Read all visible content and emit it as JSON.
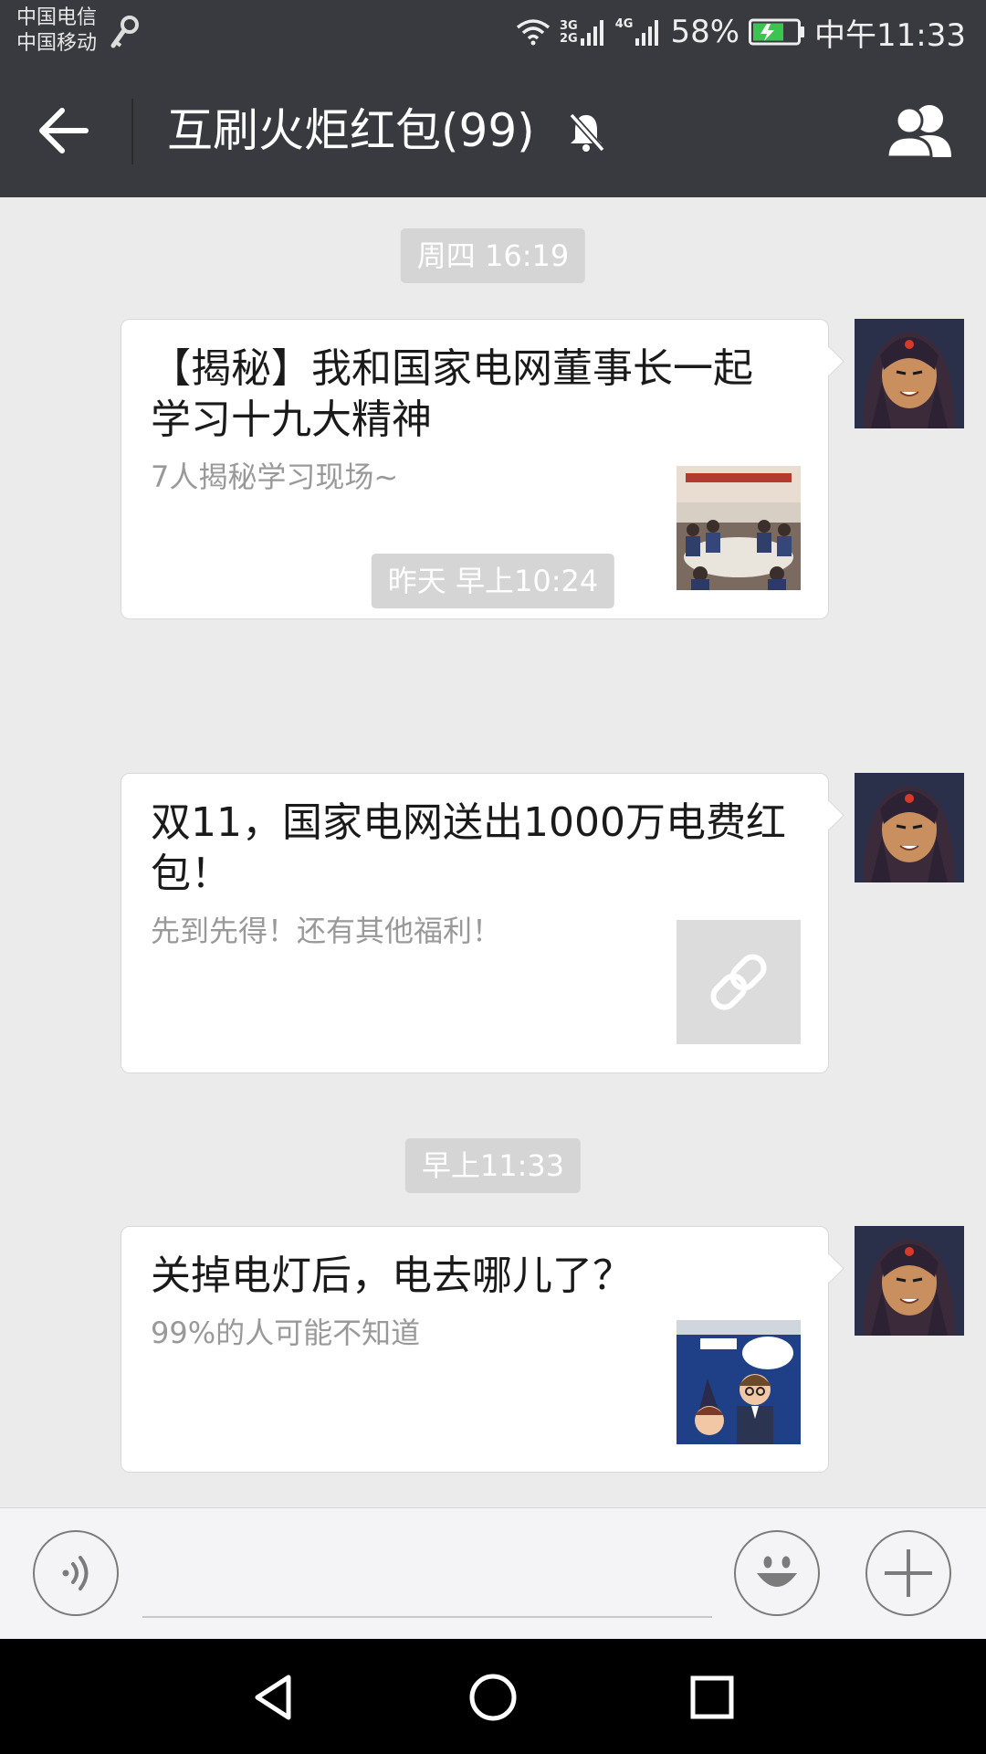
{
  "status_bar": {
    "carrier_1": "中国电信",
    "carrier_2": "中国移动",
    "network_3g": "3G",
    "network_2g": "2G",
    "network_4g": "4G",
    "battery": "58%",
    "time": "中午11:33"
  },
  "header": {
    "title": "互刷火炬红包(99)",
    "back_icon": "arrow-left-icon",
    "mute_icon": "bell-off-icon",
    "members_icon": "group-icon"
  },
  "messages": [
    {
      "time": "周四 16:19",
      "title": "【揭秘】我和国家电网董事长一起学习十九大精神",
      "desc": "7人揭秘学习现场~",
      "thumb": "meeting-photo"
    },
    {
      "time": "昨天 早上10:24",
      "title": "双11，国家电网送出1000万电费红包！",
      "desc": "先到先得！还有其他福利！",
      "thumb": "link-icon"
    },
    {
      "time": "早上11:33",
      "title": "关掉电灯后，电去哪儿了？",
      "desc": "99%的人可能不知道",
      "thumb": "cartoon-image"
    }
  ],
  "input_bar": {
    "voice_icon": "voice-icon",
    "emoji_icon": "smiley-icon",
    "plus_icon": "plus-icon"
  },
  "nav_bar": {
    "back_icon": "triangle-back-icon",
    "home_icon": "circle-home-icon",
    "recent_icon": "square-recent-icon"
  },
  "colors": {
    "header_bg": "#393a3f",
    "chat_bg": "#ebebeb",
    "bubble_bg": "#ffffff",
    "timestamp_bg": "#d5d5d5"
  }
}
